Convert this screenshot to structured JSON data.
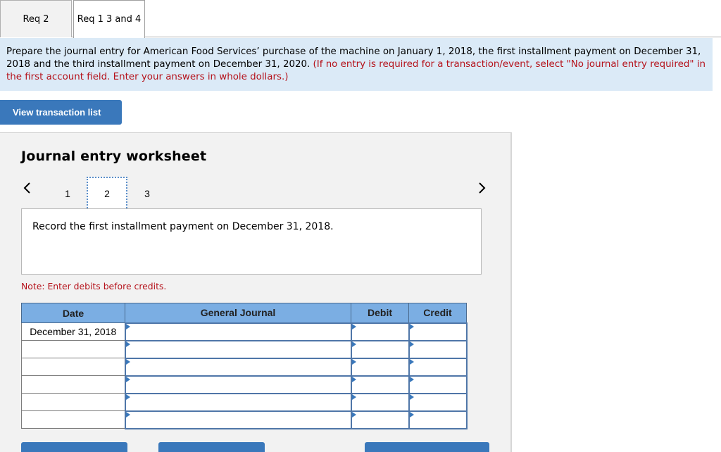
{
  "tabs": [
    {
      "label": "Req 2",
      "active": false
    },
    {
      "label": "Req 1 3 and 4",
      "active": true
    }
  ],
  "instructions": {
    "text": "Prepare the journal entry for American Food Services’ purchase of the machine on January 1, 2018, the first installment payment on December 31, 2018 and the third installment payment on December 31, 2020. ",
    "red_text": "(If no entry is required for a transaction/event, select \"No journal entry required\" in the first account field. Enter your answers in whole dollars.)"
  },
  "view_transaction_list_label": "View transaction list",
  "worksheet": {
    "title": "Journal entry worksheet",
    "pager": {
      "prev_icon": "chevron-left-icon",
      "next_icon": "chevron-right-icon",
      "pages": [
        "1",
        "2",
        "3"
      ],
      "current": "2"
    },
    "prompt": "Record the first installment payment on December 31, 2018.",
    "note": "Note: Enter debits before credits.",
    "table": {
      "headers": {
        "date": "Date",
        "general_journal": "General Journal",
        "debit": "Debit",
        "credit": "Credit"
      },
      "rows": [
        {
          "date": "December 31, 2018",
          "account": "",
          "debit": "",
          "credit": ""
        },
        {
          "date": "",
          "account": "",
          "debit": "",
          "credit": ""
        },
        {
          "date": "",
          "account": "",
          "debit": "",
          "credit": ""
        },
        {
          "date": "",
          "account": "",
          "debit": "",
          "credit": ""
        },
        {
          "date": "",
          "account": "",
          "debit": "",
          "credit": ""
        },
        {
          "date": "",
          "account": "",
          "debit": "",
          "credit": ""
        }
      ]
    }
  },
  "colors": {
    "accent_blue": "#3a78bb",
    "header_blue": "#7baee3",
    "instruction_bg": "#dbeaf7",
    "warning_red": "#b5121b",
    "panel_bg": "#f2f2f2"
  }
}
